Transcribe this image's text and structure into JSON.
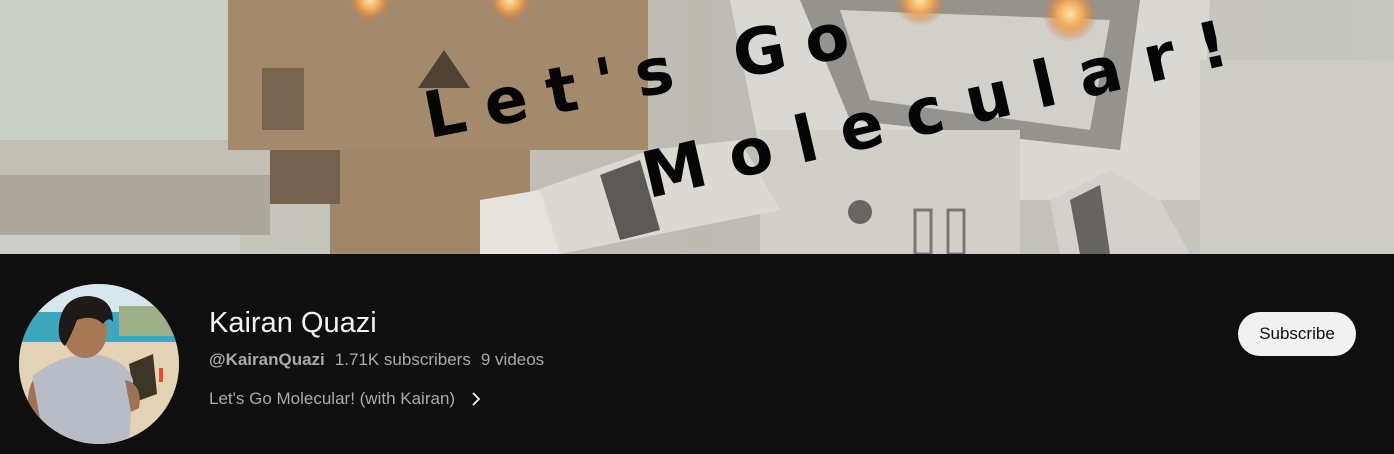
{
  "banner": {
    "line1": "Let's Go",
    "line2": "Molecular!"
  },
  "channel": {
    "name": "Kairan Quazi",
    "handle": "@KairanQuazi",
    "subscribers": "1.71K subscribers",
    "videos": "9 videos",
    "description": "Let's Go Molecular! (with Kairan)"
  },
  "actions": {
    "subscribe_label": "Subscribe"
  },
  "icons": {
    "description_more": "chevron-right-icon"
  },
  "colors": {
    "background": "#0f0f0f",
    "primary_text": "#f1f1f1",
    "secondary_text": "#aaaaaa",
    "subscribe_bg": "#f1f1f1"
  }
}
